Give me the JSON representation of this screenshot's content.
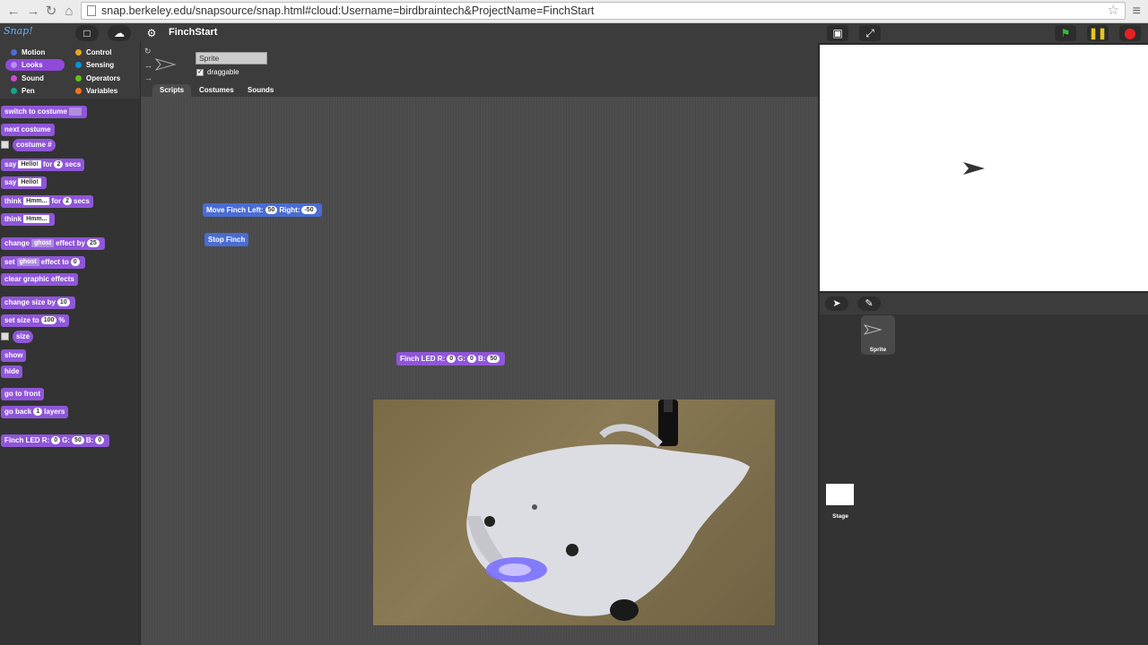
{
  "browser": {
    "url": "snap.berkeley.edu/snapsource/snap.html#cloud:Username=birdbraintech&ProjectName=FinchStart"
  },
  "app": {
    "logo_text": "Snap!",
    "project_title": "FinchStart"
  },
  "categories": [
    {
      "label": "Motion",
      "color": "#4a6cd4"
    },
    {
      "label": "Looks",
      "color": "#8f56d9",
      "selected": true
    },
    {
      "label": "Sound",
      "color": "#cf4ad9"
    },
    {
      "label": "Pen",
      "color": "#0fa88c"
    },
    {
      "label": "Control",
      "color": "#e6a822"
    },
    {
      "label": "Sensing",
      "color": "#0494dc"
    },
    {
      "label": "Operators",
      "color": "#62c213"
    },
    {
      "label": "Variables",
      "color": "#f3761d"
    }
  ],
  "palette": {
    "switch_to_costume": "switch to costume",
    "next_costume": "next costume",
    "costume_num": "costume #",
    "say": "say",
    "hello": "Hello!",
    "for": "for",
    "secs": "secs",
    "two": "2",
    "think": "think",
    "hmm": "Hmm...",
    "change": "change",
    "ghost": "ghost",
    "effect_by": "effect by",
    "twenty_five": "25",
    "set": "set",
    "effect_to": "effect to",
    "zero": "0",
    "clear_graphic_effects": "clear graphic effects",
    "change_size_by": "change size by",
    "ten": "10",
    "set_size_to": "set size to",
    "hundred": "100",
    "percent": "%",
    "size": "size",
    "show": "show",
    "hide": "hide",
    "go_to_front": "go to front",
    "go_back": "go back",
    "one": "1",
    "layers": "layers",
    "finch_led": "Finch LED",
    "r": "R:",
    "g": "G:",
    "b": "B:",
    "fifty": "50"
  },
  "sprite": {
    "name": "Sprite",
    "draggable_label": "draggable"
  },
  "tabs": [
    "Scripts",
    "Costumes",
    "Sounds"
  ],
  "scripts": {
    "move_finch_left": "Move Finch Left:",
    "left_val": "50",
    "right": "Right:",
    "right_val": "-50",
    "stop_finch": "Stop Finch",
    "finch_led": "Finch LED",
    "r": "R:",
    "r_val": "0",
    "g": "G:",
    "g_val": "0",
    "b": "B:",
    "b_val": "50"
  },
  "corral": {
    "sprite_label": "Sprite",
    "stage_label": "Stage"
  }
}
